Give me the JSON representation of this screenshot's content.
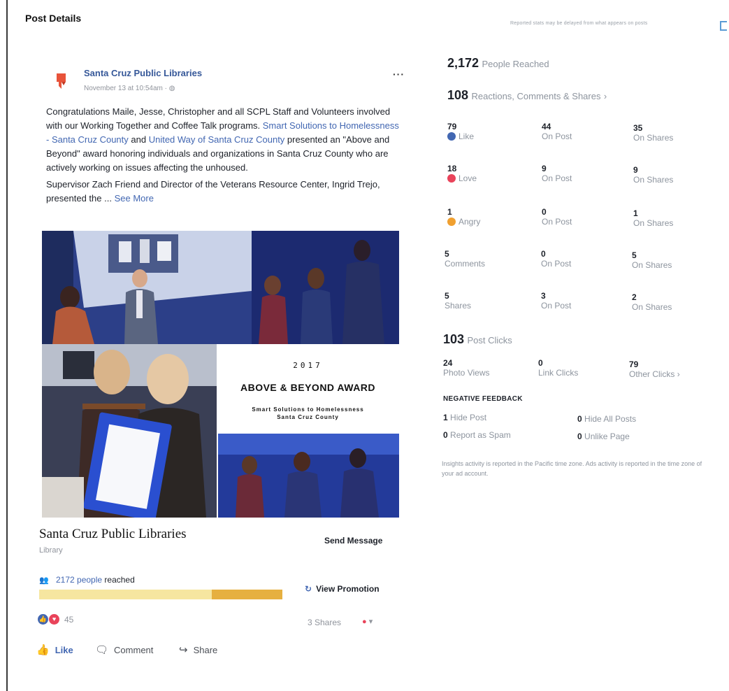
{
  "header": {
    "title": "Post Details",
    "note": "Reported stats may be delayed from what appears on posts"
  },
  "post": {
    "page_name": "Santa Cruz Public Libraries",
    "date": "November 13 at 10:54am",
    "paragraph1_a": "Congratulations Maile, Jesse, Christopher and all SCPL Staff and Volunteers involved with our Working Together and Coffee Talk programs. ",
    "link1": "Smart Solutions to Homelessness - Santa Cruz County",
    "paragraph1_b": " and ",
    "link2": "United Way of Santa Cruz County",
    "paragraph1_c": " presented an \"Above and Beyond\" award honoring individuals and organizations in Santa Cruz County who are actively working on issues affecting the unhoused.",
    "paragraph2": "Supervisor Zach Friend and Director of the Veterans Resource Center, Ingrid Trejo, presented the ... ",
    "see_more": "See More",
    "award": {
      "year": "2017",
      "title": "ABOVE & BEYOND AWARD",
      "subtitle1": "Smart Solutions to Homelessness",
      "subtitle2": "Santa Cruz County"
    },
    "page_name_display": "Santa Cruz Public Libraries",
    "category": "Library",
    "send_message": "Send Message",
    "reach": {
      "count_link": "2172 people",
      "suffix": " reached",
      "organic_fraction": 0.71
    },
    "view_promotion": "View Promotion",
    "reaction_count": "45",
    "shares": "3 Shares",
    "actions": {
      "like": "Like",
      "comment": "Comment",
      "share": "Share"
    }
  },
  "insights": {
    "people_reached": {
      "value": "2,172",
      "label": "People Reached"
    },
    "reactions_total": {
      "value": "108",
      "label": "Reactions, Comments & Shares"
    },
    "rows": [
      {
        "total": "79",
        "total_label": "Like",
        "on_post": "44",
        "on_post_label": "On Post",
        "on_shares": "35",
        "on_shares_label": "On Shares"
      },
      {
        "total": "18",
        "total_label": "Love",
        "on_post": "9",
        "on_post_label": "On Post",
        "on_shares": "9",
        "on_shares_label": "On Shares"
      },
      {
        "total": "1",
        "total_label": "Angry",
        "on_post": "0",
        "on_post_label": "On Post",
        "on_shares": "1",
        "on_shares_label": "On Shares"
      },
      {
        "total": "5",
        "total_label": "Comments",
        "on_post": "0",
        "on_post_label": "On Post",
        "on_shares": "5",
        "on_shares_label": "On Shares"
      },
      {
        "total": "5",
        "total_label": "Shares",
        "on_post": "3",
        "on_post_label": "On Post",
        "on_shares": "2",
        "on_shares_label": "On Shares"
      }
    ],
    "post_clicks": {
      "value": "103",
      "label": "Post Clicks"
    },
    "clicks": [
      {
        "value": "24",
        "label": "Photo Views"
      },
      {
        "value": "0",
        "label": "Link Clicks"
      },
      {
        "value": "79",
        "label": "Other Clicks"
      }
    ],
    "negative": {
      "title": "NEGATIVE FEEDBACK",
      "hide_post": {
        "value": "1",
        "label": "Hide Post"
      },
      "hide_all": {
        "value": "0",
        "label": "Hide All Posts"
      },
      "spam": {
        "value": "0",
        "label": "Report as Spam"
      },
      "unlike": {
        "value": "0",
        "label": "Unlike Page"
      }
    },
    "footnote": "Insights activity is reported in the Pacific time zone. Ads activity is reported in the time zone of your ad account."
  },
  "colors": {
    "link": "#4267b2",
    "like": "#4267b2",
    "love": "#e9435a",
    "angry": "#f0a030"
  }
}
